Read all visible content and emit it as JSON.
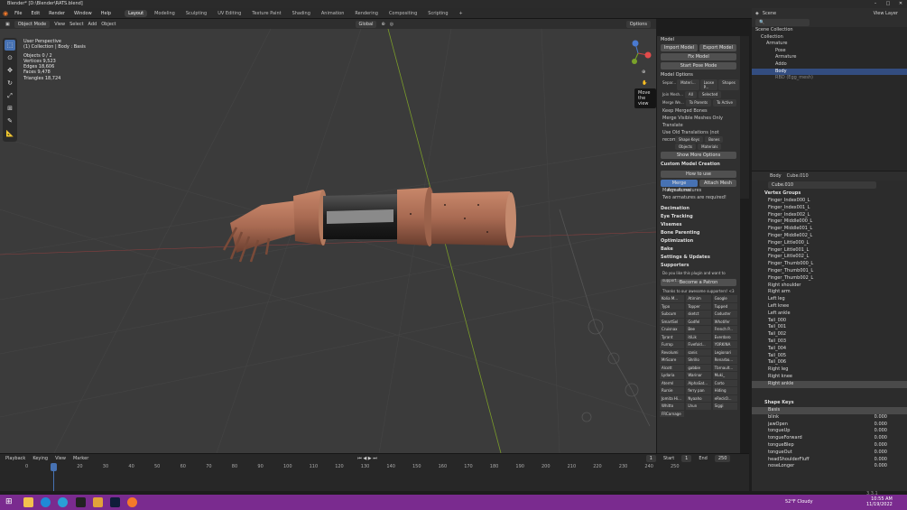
{
  "window": {
    "title": "Blender* [D:\\Blender\\RATS.blend]"
  },
  "menu": [
    "File",
    "Edit",
    "Render",
    "Window",
    "Help"
  ],
  "workspaces": [
    "Layout",
    "Modeling",
    "Sculpting",
    "UV Editing",
    "Texture Paint",
    "Shading",
    "Animation",
    "Rendering",
    "Compositing",
    "Scripting"
  ],
  "header3d": {
    "mode": "Object Mode",
    "view": "View",
    "select": "Select",
    "add": "Add",
    "object": "Object",
    "orientation": "Global",
    "options": "Options"
  },
  "stats": {
    "perspective": "User Perspective",
    "collection": "(1) Collection | Body : Basis",
    "objects": "Objects   0 / 2",
    "vertices": "Vertices   9,523",
    "edges": "Edges   18,606",
    "faces": "Faces   9,478",
    "triangles": "Triangles   18,724"
  },
  "tooltip": "Move the view",
  "npanel": {
    "model": "Model",
    "import": "Import Model",
    "export": "Export Model",
    "fix": "Fix Model",
    "pose": "Start Pose Mode",
    "options": "Model Options",
    "separate": "Separ...",
    "materi": "Materi...",
    "loose": "Loose P...",
    "shapes": "Shapes",
    "join": "Join Mesh...",
    "all": "All",
    "selected": "Selected",
    "merge": "Merge We...",
    "toparents": "To Parents",
    "toactive": "To Active",
    "keep": "Keep Merged Bones",
    "mergevis": "Merge Visible Meshes Only",
    "translate": "Translate",
    "oldtrans": "Use Old Translations (not recommended)",
    "shapekeys": "Shape Keys",
    "bones": "Bones",
    "objects": "Objects",
    "materials": "Materials",
    "more": "Show More Options",
    "custom": "Custom Model Creation",
    "howto": "How to use",
    "mergearm": "Merge Armatures",
    "attach": "Attach Mesh",
    "mergearm2": "Merge Armatures",
    "tworeq": "Two armatures are required!",
    "sections": [
      "Decimation",
      "Eye Tracking",
      "Visemes",
      "Bone Parenting",
      "Optimization",
      "Bake",
      "Settings & Updates",
      "Supporters"
    ],
    "supportmsg": "Do you like this plugin and want to support...",
    "patron": "Become a Patron",
    "thanks": "Thanks to our awesome supporters! <3"
  },
  "supporters": [
    "Kolia M...",
    "Atirnim",
    "Google",
    "Typo",
    "Topper",
    "Tupped",
    "Subcum",
    "sketct",
    "Coduster",
    "SmartSel",
    "Godfel",
    "Whotifer",
    "Cruisnax",
    "Bee",
    "French P...",
    "Tyrant",
    "itiLik",
    "Everdaro",
    "Furrop",
    "Fivefold...",
    "YORKINA",
    "Revolumi",
    "sanis",
    "Legionari",
    "MrScore",
    "Shrillo",
    "Renarbo...",
    "Alcott",
    "gabbie",
    "Tbrnault...",
    "Lydaria",
    "Warinar",
    "Muki_",
    "Aterml",
    "AlphaSat...",
    "Corto",
    "Rursie",
    "ferry pan",
    "Hiding",
    "Jomita Hi...",
    "Nyaaho",
    "eReckO...",
    "Whitto",
    "Lhun",
    "Siggi",
    "FRCarnage"
  ],
  "outliner": {
    "scene": "Scene",
    "viewlayer": "View Layer",
    "rows": [
      "Scene Collection",
      "Collection",
      "Armature",
      "Pose",
      "Armature",
      "Addo",
      "Body",
      "RBD (Egg_mesh)"
    ]
  },
  "props": {
    "obj": "Body",
    "mesh": "Cube.010",
    "meshfield": "Cube.010",
    "vgroups": "Vertex Groups",
    "groups": [
      "Finger_Index000_L",
      "Finger_Index001_L",
      "Finger_Index002_L",
      "Finger_Middle000_L",
      "Finger_Middle001_L",
      "Finger_Middle002_L",
      "Finger_Little000_L",
      "Finger_Little001_L",
      "Finger_Little002_L",
      "Finger_Thumb000_L",
      "Finger_Thumb001_L",
      "Finger_Thumb002_L",
      "Right shoulder",
      "Right arm",
      "Left leg",
      "Left knee",
      "Left ankle",
      "Tail_000",
      "Tail_001",
      "Tail_002",
      "Tail_003",
      "Tail_004",
      "Tail_005",
      "Tail_006",
      "Right leg",
      "Right knee",
      "Right ankle"
    ],
    "shapekeys": "Shape Keys",
    "keys": [
      {
        "n": "Basis",
        "v": ""
      },
      {
        "n": "blink",
        "v": "0.000"
      },
      {
        "n": "jawOpen",
        "v": "0.000"
      },
      {
        "n": "tongueUp",
        "v": "0.000"
      },
      {
        "n": "tongueForward",
        "v": "0.000"
      },
      {
        "n": "tongueBlep",
        "v": "0.000"
      },
      {
        "n": "tongueOut",
        "v": "0.000"
      },
      {
        "n": "headShoulderFluff",
        "v": "0.000"
      },
      {
        "n": "noseLonger",
        "v": "0.000"
      }
    ]
  },
  "timeline": {
    "playback": "Playback",
    "keying": "Keying",
    "view": "View",
    "marker": "Marker",
    "frame": "1",
    "start": "Start",
    "startval": "1",
    "end": "End",
    "endval": "250",
    "ticks": [
      "0",
      "10",
      "20",
      "30",
      "40",
      "50",
      "60",
      "70",
      "80",
      "90",
      "100",
      "110",
      "120",
      "130",
      "140",
      "150",
      "160",
      "170",
      "180",
      "190",
      "200",
      "210",
      "220",
      "230",
      "240",
      "250"
    ]
  },
  "status": {
    "version": "3.3.1"
  },
  "taskbar": {
    "weather": "52°F Cloudy",
    "time": "10:55 AM",
    "date": "11/19/2022"
  }
}
